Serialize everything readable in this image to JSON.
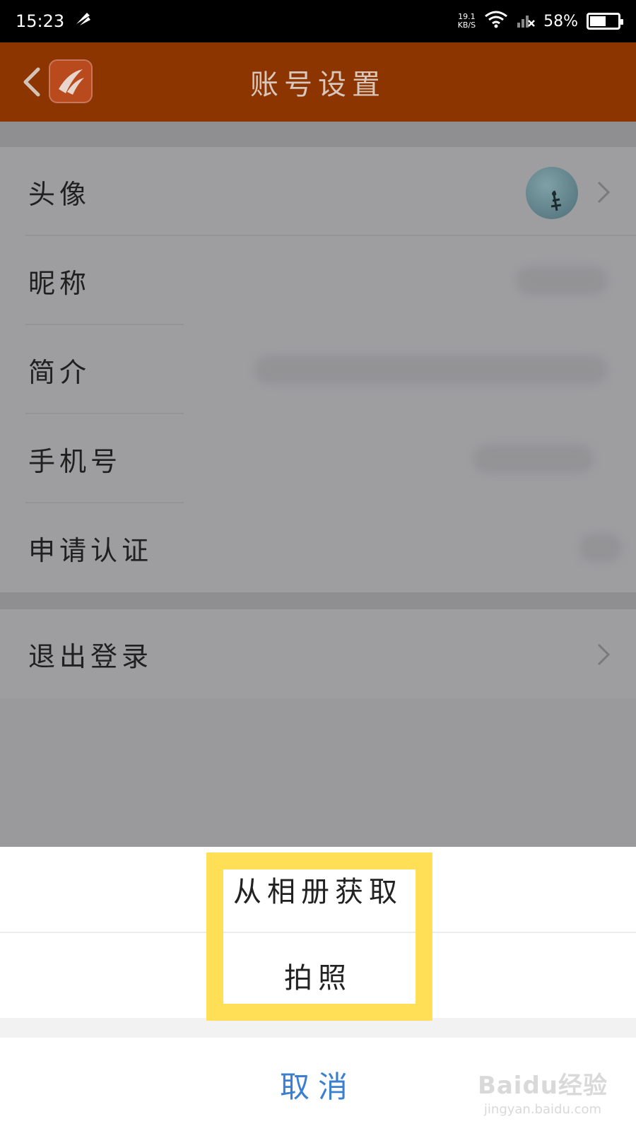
{
  "status_bar": {
    "time": "15:23",
    "net_speed_value": "19.1",
    "net_speed_unit": "KB/S",
    "battery": "58%",
    "battery_level": 0.58
  },
  "header": {
    "title": "账号设置",
    "back_icon": "chevron-left-icon",
    "logo_icon": "app-logo-icon"
  },
  "settings": {
    "items": [
      {
        "label": "头像"
      },
      {
        "label": "昵称"
      },
      {
        "label": "简介"
      },
      {
        "label": "手机号"
      },
      {
        "label": "申请认证"
      }
    ],
    "logout": {
      "label": "退出登录"
    }
  },
  "action_sheet": {
    "options": [
      {
        "label": "从相册获取"
      },
      {
        "label": "拍照"
      }
    ],
    "cancel_label": "取消"
  },
  "watermark": {
    "main": "Baidu经验",
    "sub": "jingyan.baidu.com"
  },
  "colors": {
    "header_bg": "#8c3500",
    "highlight": "#ffdf55",
    "cancel_text": "#3a7fd0"
  }
}
